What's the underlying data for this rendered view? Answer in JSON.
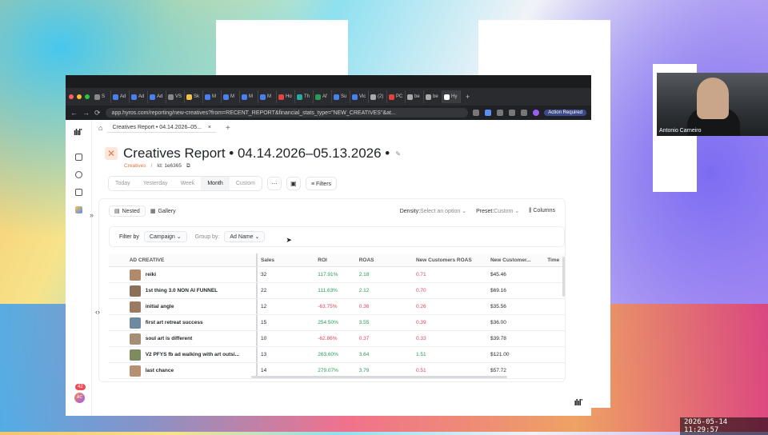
{
  "browser": {
    "tabs": [
      "S",
      "Ad",
      "Ad",
      "Ad",
      "VS",
      "Sk",
      "M",
      "M",
      "M",
      "M",
      "Ho",
      "Th",
      "Af",
      "Su",
      "Vic",
      "(2)",
      "PC",
      "be",
      "be",
      "Hy"
    ],
    "url": "app.hyros.com/reporting/new-creatives?from=RECENT_REPORT&financial_stats_type=\"NEW_CREATIVES\"&at...",
    "action_required": "Action Required"
  },
  "app_tab": {
    "label": "Creatives Report • 04.14.2026–05...",
    "close": "×",
    "add": "+"
  },
  "header": {
    "title": "Creatives Report • 04.14.2026–05.13.2026 •",
    "breadcrumb_link": "Creatives",
    "breadcrumb_sep": "/",
    "report_id": "Id: 1e6365"
  },
  "date_filters": [
    "Today",
    "Yesterday",
    "Week",
    "Month",
    "Custom"
  ],
  "date_selected": "Month",
  "toolbar": {
    "more": "···",
    "filters": "Filters"
  },
  "view": {
    "nested": "Nested",
    "gallery": "Gallery",
    "density_label": "Density:",
    "density_value": "Select an option",
    "preset_label": "Preset:",
    "preset_value": "Custom",
    "columns": "Columns"
  },
  "filter_bar": {
    "filter_by_label": "Filter by",
    "filter_by_value": "Campaign",
    "group_by_label": "Group by:",
    "group_by_value": "Ad Name"
  },
  "table": {
    "headers": [
      "AD CREATIVE",
      "Sales",
      "ROI",
      "ROAS",
      "New Customers ROAS",
      "New Customer...",
      "Time"
    ],
    "rows": [
      {
        "name": "reiki",
        "sales": "32",
        "roi": "117.91%",
        "roas": "2.18",
        "nc_roas": "0.71",
        "nc": "$45.46",
        "roi_pos": true,
        "roas_pos": true,
        "ncr_pos": false,
        "thumb": "#b08a6a"
      },
      {
        "name": "1st thing 3.0 NON AI FUNNEL",
        "sales": "22",
        "roi": "111.63%",
        "roas": "2.12",
        "nc_roas": "0.70",
        "nc": "$69.16",
        "roi_pos": true,
        "roas_pos": true,
        "ncr_pos": false,
        "thumb": "#8a6f5a"
      },
      {
        "name": "initial angle",
        "sales": "12",
        "roi": "-63.75%",
        "roas": "0.36",
        "nc_roas": "0.26",
        "nc": "$35.56",
        "roi_pos": false,
        "roas_pos": false,
        "ncr_pos": false,
        "thumb": "#9b7b62"
      },
      {
        "name": "first art retreat success",
        "sales": "15",
        "roi": "254.50%",
        "roas": "3.55",
        "nc_roas": "0.39",
        "nc": "$36.00",
        "roi_pos": true,
        "roas_pos": true,
        "ncr_pos": false,
        "thumb": "#6e8aa0"
      },
      {
        "name": "soul art is different",
        "sales": "10",
        "roi": "-62.86%",
        "roas": "0.37",
        "nc_roas": "0.33",
        "nc": "$39.78",
        "roi_pos": false,
        "roas_pos": false,
        "ncr_pos": false,
        "thumb": "#a58f74"
      },
      {
        "name": "V2 PFYS fb ad walking with art outsi...",
        "sales": "13",
        "roi": "263.60%",
        "roas": "3.64",
        "nc_roas": "1.51",
        "nc": "$121.00",
        "roi_pos": true,
        "roas_pos": true,
        "ncr_pos": true,
        "thumb": "#7d8c5f"
      },
      {
        "name": "last chance",
        "sales": "14",
        "roi": "279.07%",
        "roas": "3.79",
        "nc_roas": "0.51",
        "nc": "$57.72",
        "roi_pos": true,
        "roas_pos": true,
        "ncr_pos": false,
        "thumb": "#b69070"
      }
    ]
  },
  "rail": {
    "badge": "42",
    "avatar": "AC"
  },
  "webcam": {
    "name": "Antonio Carneiro"
  },
  "timestamp": "2026-05-14  11:29:57"
}
